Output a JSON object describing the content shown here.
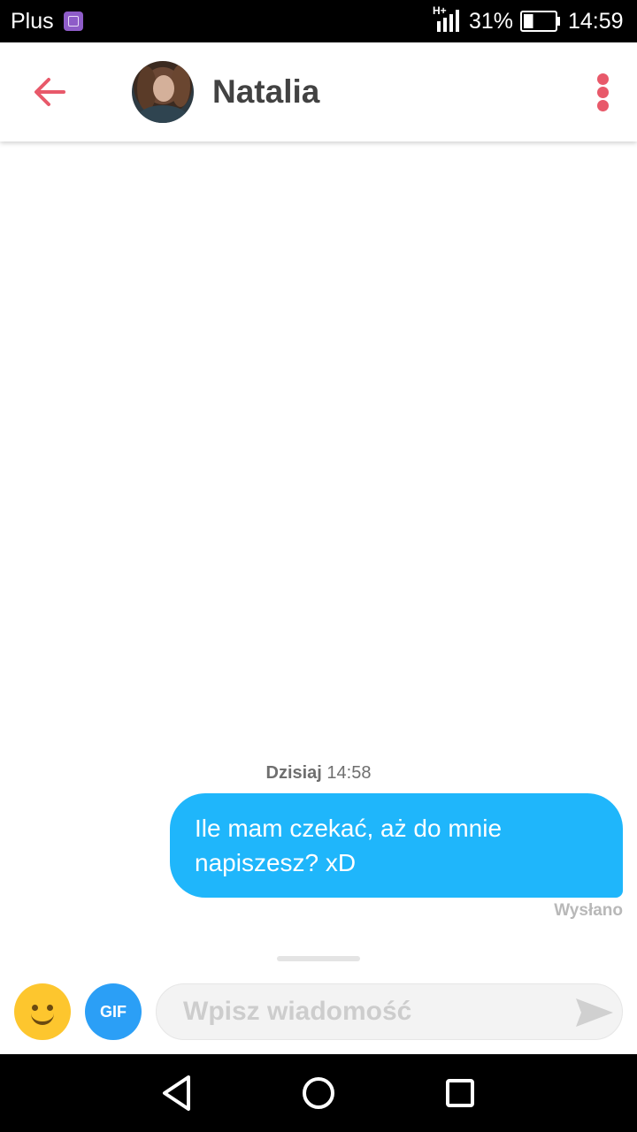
{
  "status_bar": {
    "carrier": "Plus",
    "carrier_app_icon": "gallery-app-icon",
    "network_type": "H+",
    "signal_icon": "signal-bars-icon",
    "battery_percent": "31%",
    "battery_level": 0.31,
    "battery_icon": "battery-icon",
    "time": "14:59"
  },
  "header": {
    "back_icon": "arrow-left-icon",
    "contact_name": "Natalia",
    "avatar_icon": "profile-photo",
    "menu_icon": "vertical-dots-icon"
  },
  "conversation": {
    "timestamp_day": "Dzisiaj",
    "timestamp_time": "14:58",
    "messages": [
      {
        "direction": "outgoing",
        "text": "Ile mam czekać, aż do mnie napiszesz? xD",
        "status": "Wysłano"
      }
    ]
  },
  "composer": {
    "emoji_icon": "smiley-icon",
    "gif_label": "GIF",
    "input_placeholder": "Wpisz wiadomość",
    "input_value": "",
    "send_icon": "send-icon"
  },
  "navigation_bar": {
    "back_icon": "triangle-back-icon",
    "home_icon": "circle-home-icon",
    "recents_icon": "square-recents-icon"
  },
  "colors": {
    "accent": "#e8596a",
    "outgoing_bubble": "#1fb6fb",
    "gif_button": "#2b9ff6",
    "emoji_button": "#fdc62e",
    "contact_name": "#424242",
    "status_text": "#b8b8b8",
    "timestamp": "#6f6f6f"
  }
}
